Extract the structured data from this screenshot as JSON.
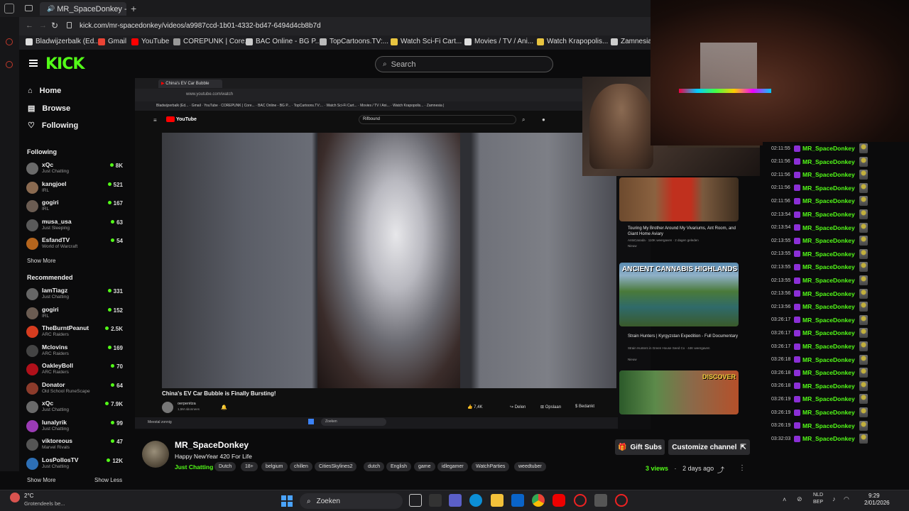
{
  "browser": {
    "tab_title": "MR_SpaceDonkey - W",
    "url": "kick.com/mr-spacedonkey/videos/a9987ccd-1b01-4332-bd47-6494d4cb8b7d",
    "bookmarks": [
      "Bladwijzerbalk (Ed...",
      "Gmail",
      "YouTube",
      "COREPUNK | Core...",
      "BAC Online - BG P...",
      "TopCartoons.TV:...",
      "Watch Sci-Fi Cart...",
      "Movies / TV / Ani...",
      "Watch Krapopolis...",
      "Zamnesia |"
    ]
  },
  "kick": {
    "logo": "KICK",
    "search_placeholder": "Search",
    "nav": [
      "Home",
      "Browse",
      "Following"
    ],
    "following_header": "Following",
    "following": [
      {
        "name": "xQc",
        "cat": "Just Chatting",
        "viewers": "8K",
        "color": "#6a6a6a"
      },
      {
        "name": "kangjoel",
        "cat": "IRL",
        "viewers": "521",
        "color": "#8a6a50"
      },
      {
        "name": "gogiri",
        "cat": "IRL",
        "viewers": "167",
        "color": "#6b5c52"
      },
      {
        "name": "musa_usa",
        "cat": "Just Sleeping",
        "viewers": "63",
        "color": "#5a5a5a"
      },
      {
        "name": "EsfandTV",
        "cat": "World of Warcraft",
        "viewers": "54",
        "color": "#b5651d"
      }
    ],
    "show_more_1": "Show More",
    "recommended_header": "Recommended",
    "recommended": [
      {
        "name": "IamTiagz",
        "cat": "Just Chatting",
        "viewers": "331",
        "color": "#666"
      },
      {
        "name": "gogiri",
        "cat": "IRL",
        "viewers": "152",
        "color": "#6b5c52"
      },
      {
        "name": "TheBurntPeanut",
        "cat": "ARC Raiders",
        "viewers": "2.5K",
        "color": "#d63c1f"
      },
      {
        "name": "Mclovins",
        "cat": "ARC Raiders",
        "viewers": "169",
        "color": "#444"
      },
      {
        "name": "OakleyBoll",
        "cat": "ARC Raiders",
        "viewers": "70",
        "color": "#b0101a"
      },
      {
        "name": "Donator",
        "cat": "Old School RuneScape",
        "viewers": "64",
        "color": "#8c3b2b"
      },
      {
        "name": "xQc",
        "cat": "Just Chatting",
        "viewers": "7.9K",
        "color": "#6a6a6a"
      },
      {
        "name": "lunalyrik",
        "cat": "Just Chatting",
        "viewers": "99",
        "color": "#9b3bb5"
      },
      {
        "name": "viktoreous",
        "cat": "Marvel Rivals",
        "viewers": "47",
        "color": "#555"
      },
      {
        "name": "LosPollosTV",
        "cat": "Just Chatting",
        "viewers": "12K",
        "color": "#2d6fb5"
      }
    ],
    "show_more_2": "Show More",
    "show_less": "Show Less"
  },
  "inner": {
    "tab_title": "China's EV Car Bubble",
    "url": "www.youtube.com/watch",
    "yt_search": "Rifbound",
    "video_title": "China's EV Car Bubble is Finally Bursting!",
    "channel": "oerpenitza",
    "subs": "1,5M abonnees",
    "likes": "7,4K",
    "share": "Delen",
    "save": "Opslaan",
    "thanks": "Bedankt",
    "recs": [
      {
        "title": "Touring My Brother Around My Vivariums, Ant Room, and Giant Home Aviary",
        "sub": "AntsCanada · 110K weergaven · 2 dagen geleden",
        "badge": "Nieuw"
      },
      {
        "title": "Strain Hunters | Kyrgyzstan Expedition - Full Documentary",
        "sub": "Strain Hunters in Green House Seed Co · 44K weergaven",
        "badge": "Nieuw",
        "thumb_text": "ANCIENT CANNABIS HIGHLANDS"
      },
      {
        "title": "",
        "sub": "",
        "badge": "",
        "thumb_text": "DISCOVER"
      }
    ],
    "taskbar_search": "Zoeken",
    "weather": "Meestal zonnig"
  },
  "channel": {
    "name": "MR_SpaceDonkey",
    "title": "Happy NewYear 420 For Life",
    "category": "Just Chatting",
    "tags": [
      "Dutch",
      "18+",
      "belgium",
      "chillen",
      "CitiesSkylines2",
      "dutch",
      "English",
      "game",
      "idlegamer",
      "WatchParties",
      "weedtuber"
    ],
    "views": "3 views",
    "age": "2 days ago",
    "gift_subs": "Gift Subs",
    "customize": "Customize channel"
  },
  "chat": {
    "username": "MR_SpaceDonkey",
    "times": [
      "02:11:55",
      "02:11:56",
      "02:11:56",
      "02:11:56",
      "02:11:56",
      "02:13:54",
      "02:13:54",
      "02:13:55",
      "02:13:55",
      "02:13:55",
      "02:13:55",
      "02:13:56",
      "02:13:56",
      "03:26:17",
      "03:26:17",
      "03:26:17",
      "03:26:18",
      "03:26:18",
      "03:26:18",
      "03:26:19",
      "03:26:19",
      "03:26:19",
      "03:32:03"
    ]
  },
  "taskbar": {
    "weather_temp": "2°C",
    "weather_desc": "Grotendeels be...",
    "search": "Zoeken",
    "lang": "NLD",
    "lang2": "BEP",
    "time": "9:29",
    "date": "2/01/2026"
  },
  "colors": {
    "kick_green": "#53fc18",
    "chat_green": "#53fc18"
  }
}
